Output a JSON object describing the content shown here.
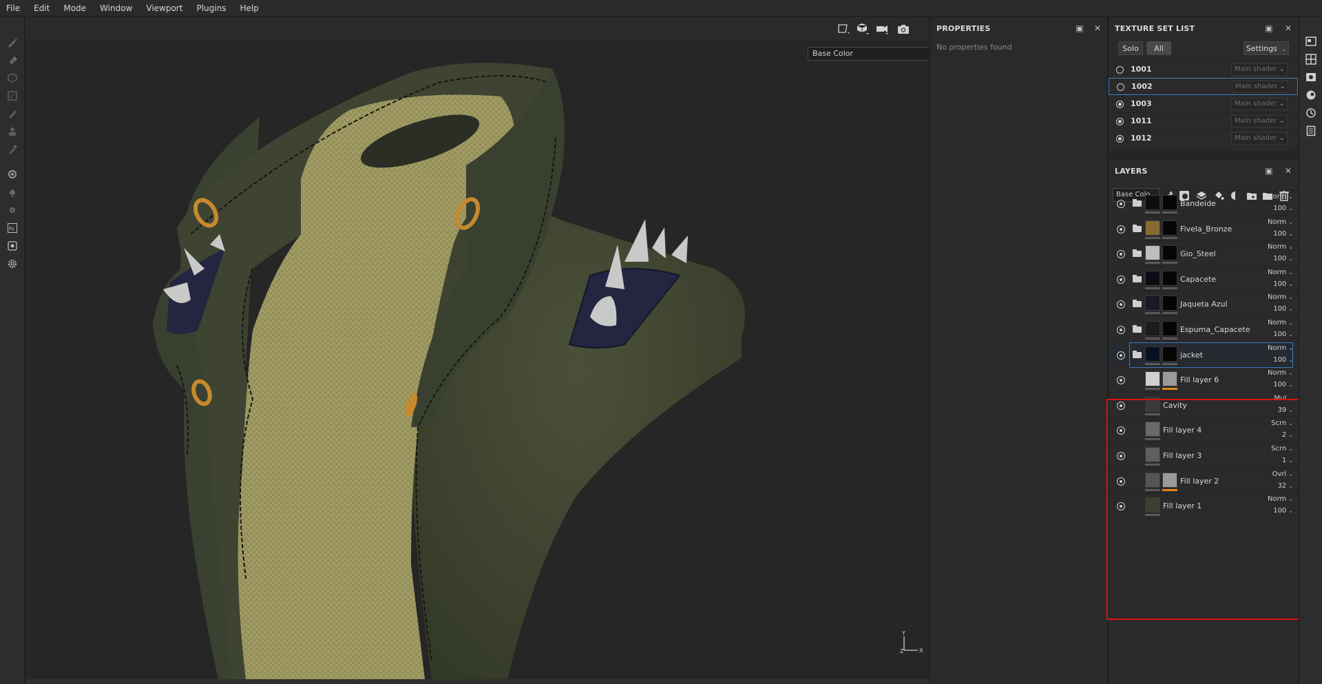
{
  "menu": {
    "items": [
      "File",
      "Edit",
      "Mode",
      "Window",
      "Viewport",
      "Plugins",
      "Help"
    ]
  },
  "left_toolbar": {
    "tools": [
      "paint-brush-icon",
      "eraser-icon",
      "projection-icon",
      "polygon-fill-icon",
      "smudge-icon",
      "clone-icon",
      "color-picker-icon",
      "bake-icon",
      "notification-icon",
      "settings-cog-icon",
      "photoshop-icon",
      "export-icon",
      "preferences-icon"
    ],
    "photoshop_label": "Ps"
  },
  "viewport": {
    "icons": [
      "camera-frame-icon",
      "cube-icon",
      "video-camera-icon",
      "screenshot-camera-icon"
    ],
    "channel_select": "Base Color",
    "axis": {
      "y": "Y",
      "z": "Z",
      "x": "X"
    }
  },
  "properties": {
    "title": "PROPERTIES",
    "empty_message": "No properties found"
  },
  "texture_set_list": {
    "title": "TEXTURE SET LIST",
    "solo_label": "Solo",
    "all_label": "All",
    "settings_label": "Settings",
    "rows": [
      {
        "name": "1001",
        "shader": "Main shader",
        "enabled": false,
        "selected": false
      },
      {
        "name": "1002",
        "shader": "Main shader",
        "enabled": false,
        "selected": true
      },
      {
        "name": "1003",
        "shader": "Main shader",
        "enabled": true,
        "selected": false
      },
      {
        "name": "1011",
        "shader": "Main shader",
        "enabled": true,
        "selected": false
      },
      {
        "name": "1012",
        "shader": "Main shader",
        "enabled": true,
        "selected": false
      }
    ]
  },
  "layers": {
    "title": "LAYERS",
    "channel_select": "Base Colo",
    "toolbar_icons": [
      "magic-wand-icon",
      "add-mask-icon",
      "add-layer-icon",
      "fill-layer-icon",
      "add-effect-icon",
      "folder-add-icon",
      "folder-icon",
      "delete-icon"
    ],
    "rows": [
      {
        "name": "Bandeide",
        "blend": "Norm",
        "opacity": "100",
        "folder": true
      },
      {
        "name": "Fivela_Bronze",
        "blend": "Norm",
        "opacity": "100",
        "folder": true
      },
      {
        "name": "Gio_Steel",
        "blend": "Norm",
        "opacity": "100",
        "folder": true
      },
      {
        "name": "Capacete",
        "blend": "Norm",
        "opacity": "100",
        "folder": true
      },
      {
        "name": "Jaqueta Azul",
        "blend": "Norm",
        "opacity": "100",
        "folder": true
      },
      {
        "name": "Espuma_Capacete",
        "blend": "Norm",
        "opacity": "100",
        "folder": true
      },
      {
        "name": "jacket",
        "blend": "Norm",
        "opacity": "100",
        "folder": true,
        "open": true,
        "selected": true
      },
      {
        "name": "Fill layer 6",
        "blend": "Norm",
        "opacity": "100",
        "folder": false,
        "orange_mask": true
      },
      {
        "name": "Cavity",
        "blend": "Mul",
        "opacity": "39",
        "folder": false
      },
      {
        "name": "Fill layer 4",
        "blend": "Scrn",
        "opacity": "2",
        "folder": false
      },
      {
        "name": "Fill layer 3",
        "blend": "Scrn",
        "opacity": "1",
        "folder": false
      },
      {
        "name": "Fill layer 2",
        "blend": "Ovrl",
        "opacity": "32",
        "folder": false,
        "orange_mask": true
      },
      {
        "name": "Fill layer 1",
        "blend": "Norm",
        "opacity": "100",
        "folder": false
      }
    ]
  },
  "right_dock": {
    "icons": [
      "shelf-icon",
      "uv-grid-icon",
      "display-settings-icon",
      "environment-icon",
      "history-icon",
      "log-icon"
    ]
  },
  "colors": {
    "accent": "#3b7fc4",
    "annotation": "#e01010",
    "mask_orange": "#e6871f",
    "jacket_leather": "#3f4530",
    "knit": "#a6a06a",
    "brass": "#c58a2e",
    "strap": "#232541"
  }
}
